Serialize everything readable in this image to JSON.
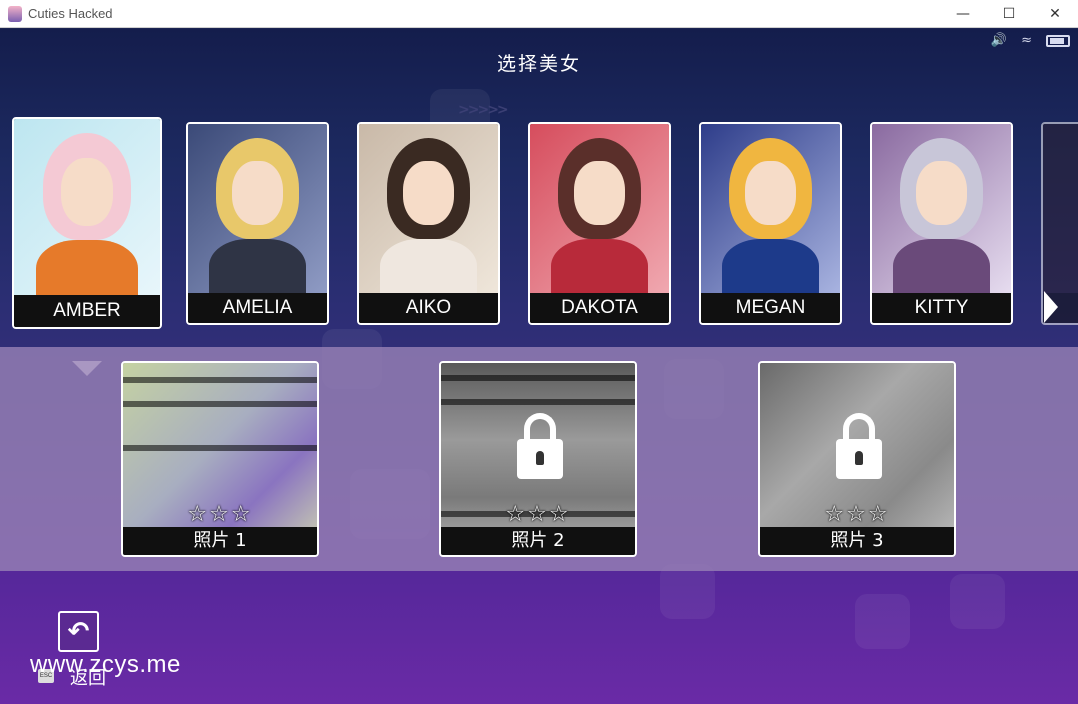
{
  "window": {
    "title": "Cuties Hacked",
    "minimize": "—",
    "maximize": "☐",
    "close": "✕"
  },
  "screen": {
    "title": "选择美女",
    "status_icons": [
      "volume-icon",
      "wifi-icon",
      "battery-icon"
    ]
  },
  "characters": [
    {
      "name": "AMBER",
      "selected": true,
      "hair": "#f4c9d4",
      "top": "#e67a2a"
    },
    {
      "name": "AMELIA",
      "selected": false,
      "hair": "#e8c86a",
      "top": "#2f3445"
    },
    {
      "name": "AIKO",
      "selected": false,
      "hair": "#3a2a22",
      "top": "#efe7df"
    },
    {
      "name": "DAKOTA",
      "selected": false,
      "hair": "#5a2f2a",
      "top": "#b82a3a"
    },
    {
      "name": "MEGAN",
      "selected": false,
      "hair": "#f0b640",
      "top": "#1d3a8a"
    },
    {
      "name": "KITTY",
      "selected": false,
      "hair": "#c8c6d8",
      "top": "#6a4a7a"
    }
  ],
  "photos": [
    {
      "label": "照片 1",
      "stars": "☆☆☆",
      "locked": false
    },
    {
      "label": "照片 2",
      "stars": "☆☆☆",
      "locked": true
    },
    {
      "label": "照片 3",
      "stars": "☆☆☆",
      "locked": true
    }
  ],
  "bottom": {
    "back_icon": "↶",
    "esc_key": "ESC",
    "back_label": "返回",
    "watermark": "www.zcys.me"
  }
}
